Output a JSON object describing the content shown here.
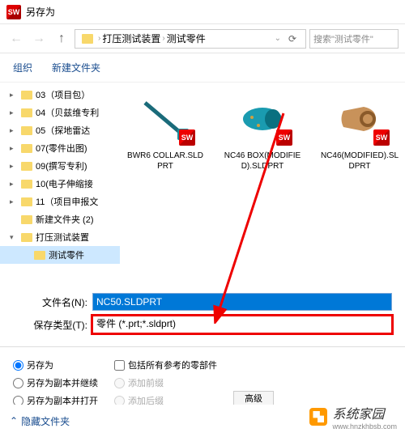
{
  "title": "另存为",
  "nav": {
    "path1": "打压测试装置",
    "path2": "测试零件",
    "search_placeholder": "搜索\"测试零件\""
  },
  "toolbar": {
    "organize": "组织",
    "new_folder": "新建文件夹"
  },
  "tree": {
    "items": [
      {
        "label": "03（项目包）",
        "caret": "▸",
        "indent": 0
      },
      {
        "label": "04（贝兹维专利",
        "caret": "▸",
        "indent": 0
      },
      {
        "label": "05（探地雷达",
        "caret": "▸",
        "indent": 0
      },
      {
        "label": "07(零件出图)",
        "caret": "▸",
        "indent": 0
      },
      {
        "label": "09(撰写专利)",
        "caret": "▸",
        "indent": 0
      },
      {
        "label": "10(电子伸缩接",
        "caret": "▸",
        "indent": 0
      },
      {
        "label": "11（项目申报文",
        "caret": "▸",
        "indent": 0
      },
      {
        "label": "新建文件夹 (2)",
        "caret": "",
        "indent": 0
      },
      {
        "label": "打压测试装置",
        "caret": "▾",
        "indent": 0
      },
      {
        "label": "测试零件",
        "caret": "",
        "indent": 1,
        "selected": true
      }
    ]
  },
  "files": [
    {
      "name": "BWR6 COLLAR.SLDPRT",
      "thumb": "rod"
    },
    {
      "name": "NC46 BOX(MODIFIED).SLDPRT",
      "thumb": "cyl"
    },
    {
      "name": "NC46(MODIFIED).SLDPRT",
      "thumb": "clamp"
    }
  ],
  "fields": {
    "filename_label": "文件名(N):",
    "filename_value": "NC50.SLDPRT",
    "filetype_label": "保存类型(T):",
    "filetype_value": "零件 (*.prt;*.sldprt)"
  },
  "options": {
    "save_as": "另存为",
    "save_copy_continue": "另存为副本并继续",
    "save_copy_open": "另存为副本并打开",
    "include_refs": "包括所有参考的零部件",
    "add_prefix": "添加前缀",
    "add_suffix": "添加后缀",
    "advanced": "高级"
  },
  "footer": {
    "hide_folders": "隐藏文件夹"
  },
  "watermark": {
    "text": "系统家园",
    "url": "www.hnzkhbsb.com"
  }
}
